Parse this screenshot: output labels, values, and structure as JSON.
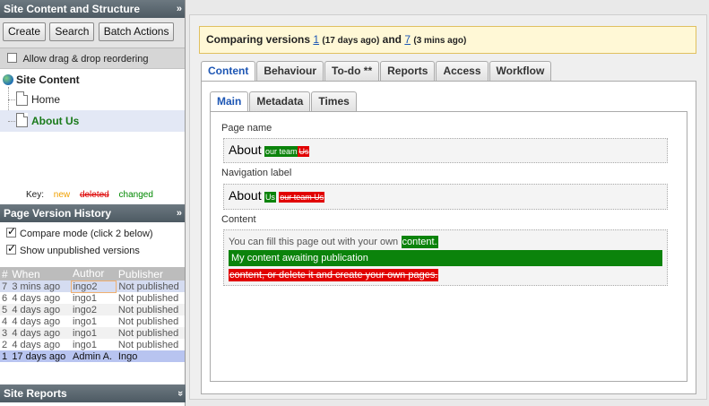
{
  "left": {
    "content_panel": {
      "title": "Site Content and Structure",
      "toggle": "»",
      "buttons": [
        "Create",
        "Search",
        "Batch Actions"
      ],
      "drag_label": "Allow drag & drop reordering",
      "tree": {
        "root": "Site Content",
        "items": [
          {
            "label": "Home"
          },
          {
            "label": "About Us"
          }
        ]
      },
      "key": {
        "label": "Key:",
        "new": "new",
        "deleted": "deleted",
        "changed": "changed"
      }
    },
    "history_panel": {
      "title": "Page Version History",
      "toggle": "»",
      "compare_mode": "Compare mode (click 2 below)",
      "show_unpublished": "Show unpublished versions",
      "columns": [
        "#",
        "When",
        "Author",
        "Publisher"
      ],
      "rows": [
        {
          "num": "7",
          "when": "3 mins ago",
          "author": "ingo2",
          "publisher": "Not published"
        },
        {
          "num": "6",
          "when": "4 days ago",
          "author": "ingo1",
          "publisher": "Not published"
        },
        {
          "num": "5",
          "when": "4 days ago",
          "author": "ingo2",
          "publisher": "Not published"
        },
        {
          "num": "4",
          "when": "4 days ago",
          "author": "ingo1",
          "publisher": "Not published"
        },
        {
          "num": "3",
          "when": "4 days ago",
          "author": "ingo1",
          "publisher": "Not published"
        },
        {
          "num": "2",
          "when": "4 days ago",
          "author": "ingo1",
          "publisher": "Not published"
        },
        {
          "num": "1",
          "when": "17 days ago",
          "author": "Admin A.",
          "publisher": "Ingo"
        }
      ]
    },
    "reports_panel": {
      "title": "Site Reports",
      "toggle": "»"
    }
  },
  "right": {
    "compare": {
      "prefix": "Comparing versions",
      "v1": "1",
      "v1_age": "(17 days ago)",
      "and": "and",
      "v2": "7",
      "v2_age": "(3 mins ago)"
    },
    "tabs": [
      "Content",
      "Behaviour",
      "To-do **",
      "Reports",
      "Access",
      "Workflow"
    ],
    "subtabs": [
      "Main",
      "Metadata",
      "Times"
    ],
    "fields": {
      "page_name": {
        "label": "Page name",
        "base": "About",
        "inserted": "our team",
        "deleted": "Us"
      },
      "nav_label": {
        "label": "Navigation label",
        "base": "About",
        "inserted": "Us",
        "deleted": "our team Us"
      },
      "content": {
        "label": "Content",
        "line1": "You can fill this page out with your own",
        "line1_inserted": "content.",
        "inserted_block": "My content awaiting publication",
        "deleted_block": "content, or delete it and create your own pages."
      }
    }
  }
}
